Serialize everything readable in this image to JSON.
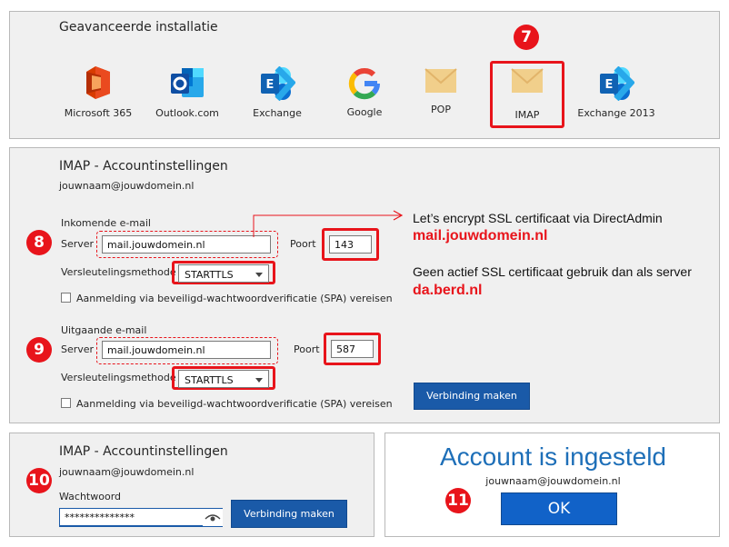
{
  "providers": {
    "heading": "Geavanceerde installatie",
    "items": [
      {
        "label": "Microsoft 365",
        "icon": "office365-icon"
      },
      {
        "label": "Outlook.com",
        "icon": "outlook-icon"
      },
      {
        "label": "Exchange",
        "icon": "exchange-icon"
      },
      {
        "label": "Google",
        "icon": "google-icon"
      },
      {
        "label": "POP",
        "icon": "envelope-icon"
      },
      {
        "label": "IMAP",
        "icon": "envelope-icon"
      },
      {
        "label": "Exchange 2013",
        "icon": "exchange-icon"
      }
    ],
    "badge": "7"
  },
  "settings": {
    "heading": "IMAP - Accountinstellingen",
    "email": "jouwnaam@jouwdomein.nl",
    "incoming": {
      "section_label": "Inkomende e-mail",
      "badge": "8",
      "server_label": "Server",
      "server_value": "mail.jouwdomein.nl",
      "port_label": "Poort",
      "port_value": "143",
      "encryption_label": "Versleutelingsmethode",
      "encryption_value": "STARTTLS",
      "spa_label": "Aanmelding via beveiligd-wachtwoordverificatie (SPA) vereisen"
    },
    "outgoing": {
      "section_label": "Uitgaande e-mail",
      "badge": "9",
      "server_label": "Server",
      "server_value": "mail.jouwdomein.nl",
      "port_label": "Poort",
      "port_value": "587",
      "encryption_label": "Versleutelingsmethode",
      "encryption_value": "STARTTLS",
      "spa_label": "Aanmelding via beveiligd-wachtwoordverificatie (SPA) vereisen"
    },
    "connect_button": "Verbinding maken",
    "annotation": {
      "line1": "Let’s encrypt SSL certificaat via DirectAdmin",
      "line2": "mail.jouwdomein.nl",
      "line3": "Geen actief SSL certificaat gebruik dan als server",
      "line4": "da.berd.nl"
    }
  },
  "password_panel": {
    "heading": "IMAP - Accountinstellingen",
    "email": "jouwnaam@jouwdomein.nl",
    "badge": "10",
    "password_label": "Wachtwoord",
    "password_value": "**************",
    "connect_button": "Verbinding maken"
  },
  "done_panel": {
    "heading": "Account is ingesteld",
    "email": "jouwnaam@jouwdomein.nl",
    "badge": "11",
    "ok_button": "OK"
  },
  "colors": {
    "accent_red": "#e8141b",
    "button_blue": "#1a5aa8",
    "panel_bg": "#f0f0f0",
    "heading_blue": "#1e6fb8"
  }
}
